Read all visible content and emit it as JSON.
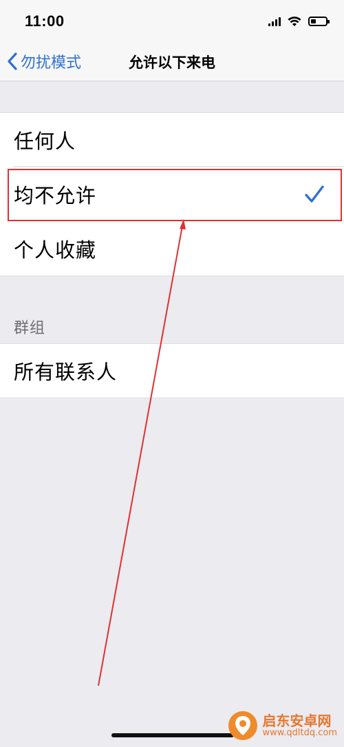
{
  "status_bar": {
    "time": "11:00",
    "signal_bars": 4,
    "battery_level": 0.35
  },
  "nav": {
    "back_label": "勿扰模式",
    "title": "允许以下来电"
  },
  "list": {
    "options": [
      {
        "label": "任何人",
        "selected": false
      },
      {
        "label": "均不允许",
        "selected": true
      },
      {
        "label": "个人收藏",
        "selected": false
      }
    ],
    "groups_header": "群组",
    "group_items": [
      {
        "label": "所有联系人"
      }
    ]
  },
  "icons": {
    "back": "chevron-left-icon",
    "check": "checkmark-icon"
  },
  "colors": {
    "accent": "#2f6fd6",
    "annotation": "#e03030",
    "background": "#ebebf0"
  },
  "watermark": {
    "name": "启东安卓网",
    "url": "www.qdltdq.com"
  }
}
